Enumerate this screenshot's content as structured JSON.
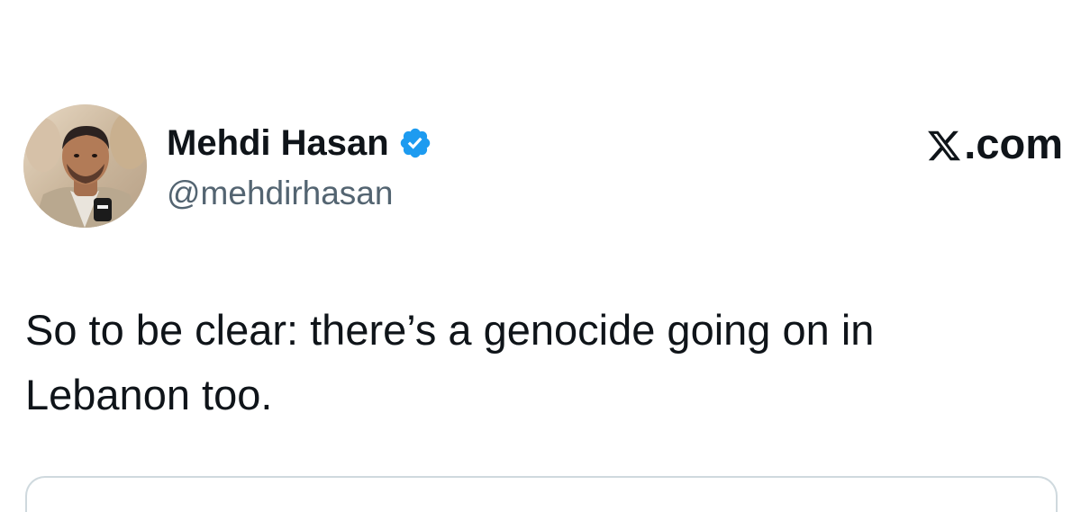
{
  "author": {
    "display_name": "Mehdi Hasan",
    "handle": "@mehdirhasan",
    "verified": true,
    "verified_badge_color": "#1d9bf0"
  },
  "brand": {
    "label": ".com",
    "icon": "x-logo-icon"
  },
  "tweet": {
    "text": "So to be clear: there’s a genocide going on in Lebanon too."
  },
  "colors": {
    "text_primary": "#0f1419",
    "text_secondary": "#536471",
    "border": "#cfd9de"
  }
}
